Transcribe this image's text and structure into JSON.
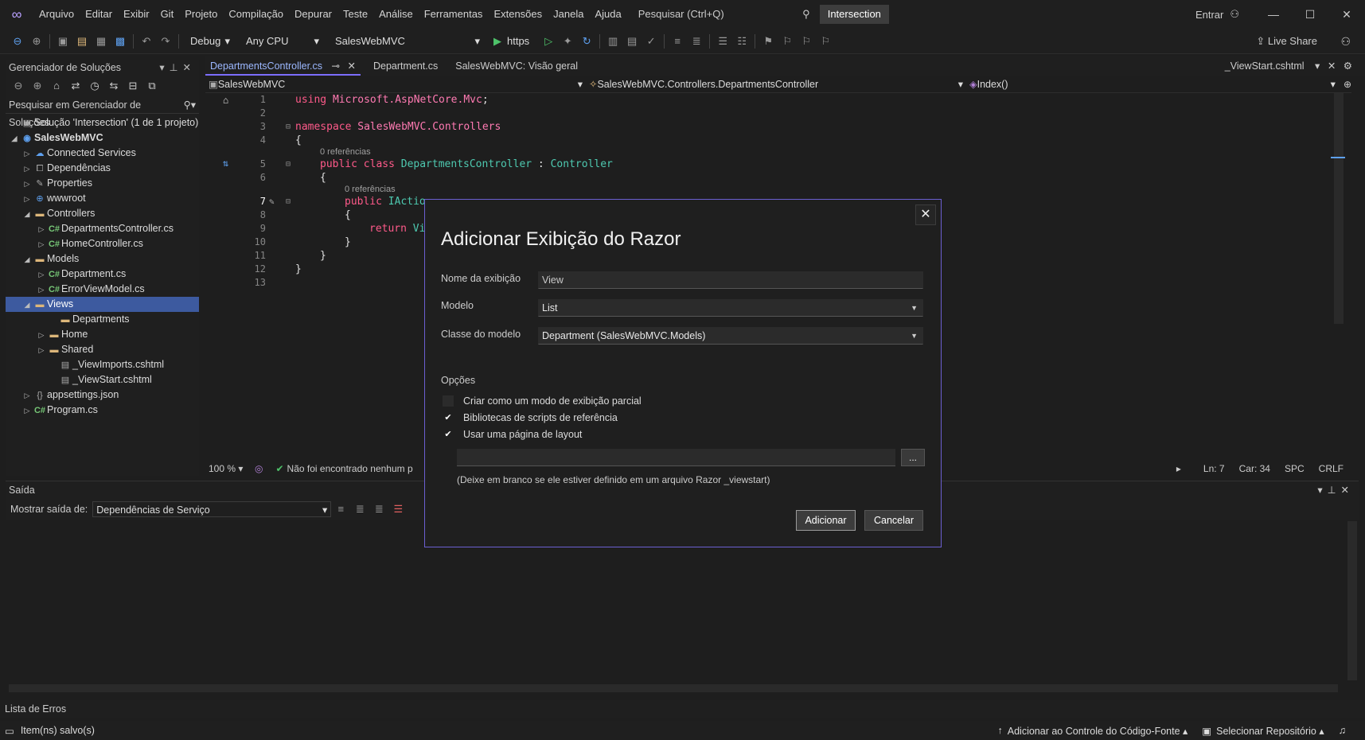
{
  "menu": [
    "Arquivo",
    "Editar",
    "Exibir",
    "Git",
    "Projeto",
    "Compilação",
    "Depurar",
    "Teste",
    "Análise",
    "Ferramentas",
    "Extensões",
    "Janela",
    "Ajuda"
  ],
  "search_placeholder": "Pesquisar (Ctrl+Q)",
  "solution_badge": "Intersection",
  "signin": "Entrar",
  "toolbar": {
    "config": "Debug",
    "platform": "Any CPU",
    "project": "SalesWebMVC",
    "run": "https",
    "live_share": "Live Share"
  },
  "solution_explorer": {
    "title": "Gerenciador de Soluções",
    "search": "Pesquisar em Gerenciador de Soluções",
    "items": [
      {
        "label": "Solução 'Intersection' (1 de 1 projeto)",
        "icon": "solution-icon"
      },
      {
        "label": "SalesWebMVC",
        "icon": "project-icon"
      },
      {
        "label": "Connected Services",
        "icon": "connected-icon"
      },
      {
        "label": "Dependências",
        "icon": "dependencies-icon"
      },
      {
        "label": "Properties",
        "icon": "wrench-icon"
      },
      {
        "label": "wwwroot",
        "icon": "globe-icon"
      },
      {
        "label": "Controllers",
        "icon": "folder-icon"
      },
      {
        "label": "DepartmentsController.cs",
        "icon": "csharp-icon"
      },
      {
        "label": "HomeController.cs",
        "icon": "csharp-icon"
      },
      {
        "label": "Models",
        "icon": "folder-icon"
      },
      {
        "label": "Department.cs",
        "icon": "csharp-icon"
      },
      {
        "label": "ErrorViewModel.cs",
        "icon": "csharp-icon"
      },
      {
        "label": "Views",
        "icon": "folder-icon"
      },
      {
        "label": "Departments",
        "icon": "folder-icon"
      },
      {
        "label": "Home",
        "icon": "folder-icon"
      },
      {
        "label": "Shared",
        "icon": "folder-icon"
      },
      {
        "label": "_ViewImports.cshtml",
        "icon": "razor-icon"
      },
      {
        "label": "_ViewStart.cshtml",
        "icon": "razor-icon"
      },
      {
        "label": "appsettings.json",
        "icon": "json-icon"
      },
      {
        "label": "Program.cs",
        "icon": "csharp-icon"
      }
    ]
  },
  "tabs": [
    "DepartmentsController.cs",
    "Department.cs",
    "SalesWebMVC: Visão geral"
  ],
  "right_tab": "_ViewStart.cshtml",
  "nav": {
    "project": "SalesWebMVC",
    "class": "SalesWebMVC.Controllers.DepartmentsController",
    "member": "Index()"
  },
  "code": {
    "line_numbers": [
      "1",
      "2",
      "3",
      "4",
      "5",
      "6",
      "7",
      "8",
      "9",
      "10",
      "11",
      "12",
      "13"
    ],
    "l1_kw": "using",
    "l1_ns": " Microsoft.AspNetCore.Mvc",
    ";": ";",
    "l3_kw": "namespace",
    "l3_ns": " SalesWebMVC.Controllers",
    "brace_open": "{",
    "brace_close": "}",
    "refs": "0 referências",
    "l5_kw": "public class",
    "l5_type": " DepartmentsController",
    "l5_sep": " : ",
    "l5_base": "Controller",
    "l7_kw": "public",
    "l7_type": " IActio",
    "l9_kw": "return",
    "l9_rest": " Vi"
  },
  "editor_status": {
    "zoom": "100 %",
    "issues": "Não foi encontrado nenhum p",
    "ln": "Ln: 7",
    "col": "Car: 34",
    "spc": "SPC",
    "crlf": "CRLF"
  },
  "output": {
    "title": "Saída",
    "show_from": "Mostrar saída de:",
    "source": "Dependências de Serviço"
  },
  "error_list": "Lista de Erros",
  "statusbar": {
    "saved": "Item(ns) salvo(s)",
    "source_control": "Adicionar ao Controle do Código-Fonte",
    "repo": "Selecionar Repositório"
  },
  "dialog": {
    "title": "Adicionar Exibição do Razor",
    "view_name_label": "Nome da exibição",
    "view_name_value": "View",
    "template_label": "Modelo",
    "template_value": "List",
    "model_class_label": "Classe do modelo",
    "model_class_value": "Department (SalesWebMVC.Models)",
    "options_label": "Opções",
    "opt_partial": "Criar como um modo de exibição parcial",
    "opt_scripts": "Bibliotecas de scripts de referência",
    "opt_layout": "Usar uma página de layout",
    "browse": "...",
    "layout_hint": "(Deixe em branco se ele estiver definido em um arquivo Razor _viewstart)",
    "add": "Adicionar",
    "cancel": "Cancelar"
  }
}
